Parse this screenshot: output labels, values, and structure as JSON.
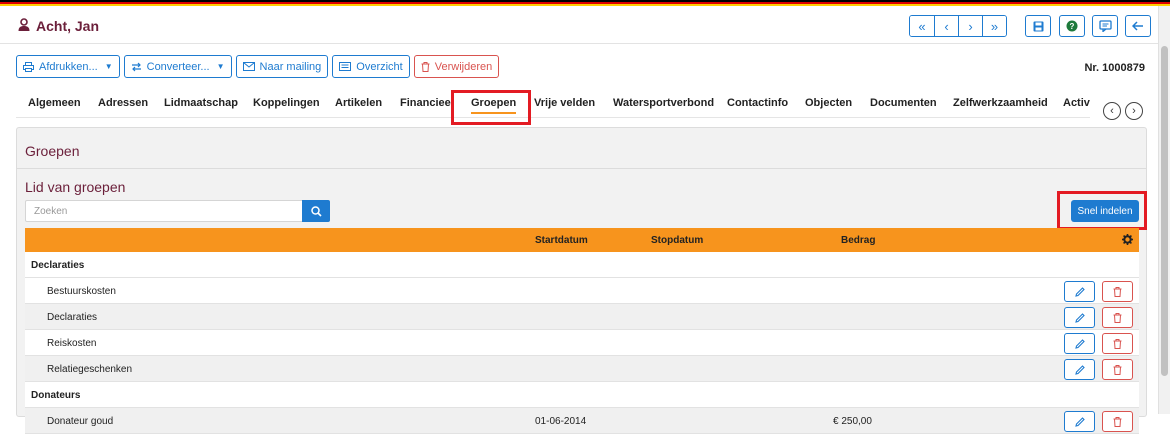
{
  "header": {
    "person_name": "Acht, Jan",
    "nav": [
      "«",
      "‹",
      "›",
      "»"
    ]
  },
  "toolbar": {
    "print_label": "Afdrukken...",
    "convert_label": "Converteer...",
    "mailing_label": "Naar mailing",
    "overview_label": "Overzicht",
    "delete_label": "Verwijderen"
  },
  "record_number": "Nr. 1000879",
  "tabs": [
    "Algemeen",
    "Adressen",
    "Lidmaatschap",
    "Koppelingen",
    "Artikelen",
    "Financieel",
    "Groepen",
    "Vrije velden",
    "Watersportverbond",
    "Contactinfo",
    "Objecten",
    "Documenten",
    "Zelfwerkzaamheid",
    "Activ"
  ],
  "active_tab": "Groepen",
  "panel": {
    "title": "Groepen",
    "subtitle": "Lid van groepen",
    "search_placeholder": "Zoeken",
    "quick_button": "Snel indelen"
  },
  "table": {
    "columns": [
      "Startdatum",
      "Stopdatum",
      "Bedrag"
    ],
    "rows": [
      {
        "type": "group",
        "name": "Declaraties"
      },
      {
        "type": "item",
        "name": "Bestuurskosten",
        "start": "",
        "stop": "",
        "amount": ""
      },
      {
        "type": "item",
        "name": "Declaraties",
        "start": "",
        "stop": "",
        "amount": ""
      },
      {
        "type": "item",
        "name": "Reiskosten",
        "start": "",
        "stop": "",
        "amount": ""
      },
      {
        "type": "item",
        "name": "Relatiegeschenken",
        "start": "",
        "stop": "",
        "amount": ""
      },
      {
        "type": "group",
        "name": "Donateurs"
      },
      {
        "type": "item",
        "name": "Donateur goud",
        "start": "01-06-2014",
        "stop": "",
        "amount": "€ 250,00"
      }
    ]
  },
  "colors": {
    "accent": "#1e7bd0",
    "title": "#6b1f3a",
    "table_header": "#f7941d",
    "danger": "#d9534f",
    "highlight": "#e31b23"
  }
}
